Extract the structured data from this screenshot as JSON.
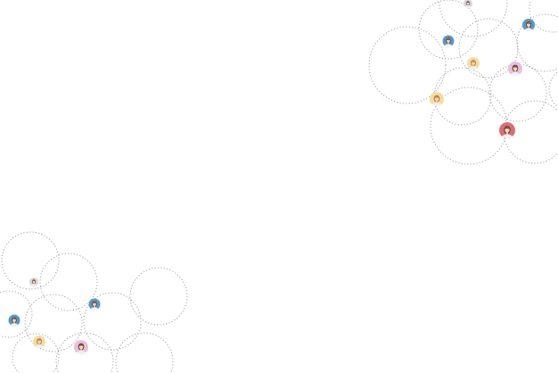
{
  "palette": {
    "background": "#ffffff",
    "ring_stroke": "#9a9a9a",
    "avatar_blue": "#5b97c3",
    "avatar_yellow": "#f2dea0",
    "avatar_pink": "#e8bfdc",
    "avatar_red": "#d96f76",
    "avatar_grey": "#d8d6dc",
    "skin": "#f6d0b8",
    "hair_dark": "#5a3a2e",
    "hair_light": "#b9743f",
    "shirt": "#eef2f6"
  },
  "decoration": {
    "type": "dotted-circle-network",
    "clusters": [
      {
        "name": "top-right-cluster",
        "avatars": [
          {
            "name": "avatar-grey-top",
            "color_key": "avatar_grey",
            "hair_key": "hair_dark"
          },
          {
            "name": "avatar-blue-right",
            "color_key": "avatar_blue",
            "hair_key": "hair_dark"
          },
          {
            "name": "avatar-blue-left",
            "color_key": "avatar_blue",
            "hair_key": "hair_dark"
          },
          {
            "name": "avatar-yellow-center",
            "color_key": "avatar_yellow",
            "hair_key": "hair_light"
          },
          {
            "name": "avatar-pink-right",
            "color_key": "avatar_pink",
            "hair_key": "hair_dark"
          },
          {
            "name": "avatar-yellow-left",
            "color_key": "avatar_yellow",
            "hair_key": "hair_light"
          },
          {
            "name": "avatar-red-bottom",
            "color_key": "avatar_red",
            "hair_key": "hair_dark"
          }
        ]
      },
      {
        "name": "bottom-left-cluster",
        "avatars": [
          {
            "name": "avatar-grey-small",
            "color_key": "avatar_grey",
            "hair_key": "hair_dark"
          },
          {
            "name": "avatar-blue-right",
            "color_key": "avatar_blue",
            "hair_key": "hair_dark"
          },
          {
            "name": "avatar-blue-left",
            "color_key": "avatar_blue",
            "hair_key": "hair_dark"
          },
          {
            "name": "avatar-yellow",
            "color_key": "avatar_yellow",
            "hair_key": "hair_light"
          },
          {
            "name": "avatar-pink",
            "color_key": "avatar_pink",
            "hair_key": "hair_dark"
          }
        ]
      }
    ]
  }
}
